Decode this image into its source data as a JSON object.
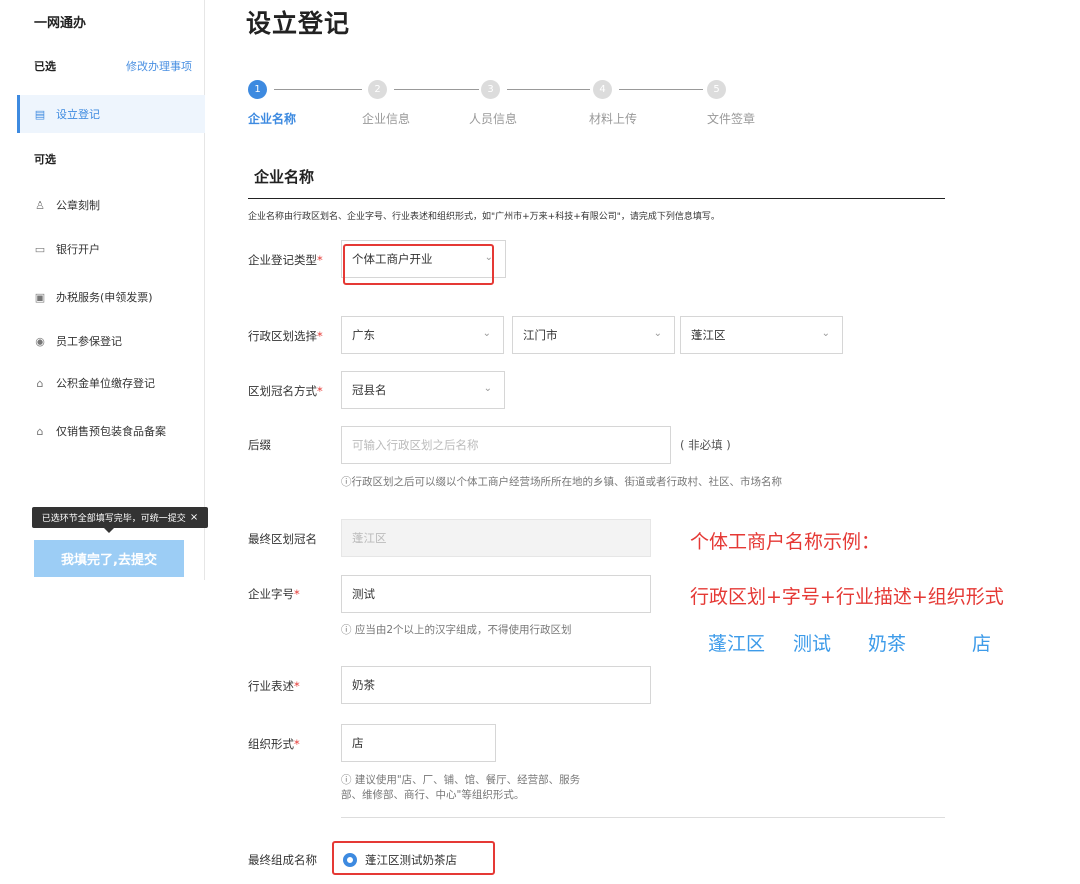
{
  "sidebar": {
    "brand": "一网通办",
    "selected_group": "已选",
    "modify_link": "修改办理事项",
    "optional_group": "可选",
    "items": [
      {
        "label": "设立登记",
        "icon": "▤"
      },
      {
        "label": "公章刻制",
        "icon": "♙"
      },
      {
        "label": "银行开户",
        "icon": "▭"
      },
      {
        "label": "办税服务(申领发票)",
        "icon": "▣"
      },
      {
        "label": "员工参保登记",
        "icon": "◉"
      },
      {
        "label": "公积金单位缴存登记",
        "icon": "⌂"
      },
      {
        "label": "仅销售预包装食品备案",
        "icon": "⌂"
      }
    ],
    "tooltip": "已选环节全部填写完毕，可统一提交",
    "tooltip_close": "×",
    "submit_label": "我填完了,去提交"
  },
  "page_title": "设立登记",
  "steps": [
    {
      "num": "1",
      "label": "企业名称"
    },
    {
      "num": "2",
      "label": "企业信息"
    },
    {
      "num": "3",
      "label": "人员信息"
    },
    {
      "num": "4",
      "label": "材料上传"
    },
    {
      "num": "5",
      "label": "文件签章"
    }
  ],
  "section": {
    "title": "企业名称",
    "description": "企业名称由行政区划名、企业字号、行业表述和组织形式，如\"广州市+万来+科技+有限公司\"，请完成下列信息填写。"
  },
  "form": {
    "reg_type": {
      "label": "企业登记类型",
      "required": "*",
      "value": "个体工商户开业"
    },
    "region": {
      "label": "行政区划选择",
      "required": "*",
      "province": "广东",
      "city": "江门市",
      "district": "蓬江区"
    },
    "prefix_mode": {
      "label": "区划冠名方式",
      "required": "*",
      "value": "冠县名"
    },
    "suffix": {
      "label": "后缀",
      "placeholder": "可输入行政区划之后名称",
      "optional": "( 非必填 )",
      "hint": "ⓘ行政区划之后可以缀以个体工商户经营场所所在地的乡镇、街道或者行政村、社区、市场名称"
    },
    "final_prefix": {
      "label": "最终区划冠名",
      "value": "蓬江区"
    },
    "trade_name": {
      "label": "企业字号",
      "required": "*",
      "value": "测试",
      "hint": "ⓘ 应当由2个以上的汉字组成，不得使用行政区划"
    },
    "industry": {
      "label": "行业表述",
      "required": "*",
      "value": "奶茶"
    },
    "org_form": {
      "label": "组织形式",
      "required": "*",
      "value": "店",
      "hint_line1": "ⓘ 建议使用\"店、厂、铺、馆、餐厅、经营部、服务",
      "hint_line2": "部、维修部、商行、中心\"等组织形式。"
    },
    "final_name": {
      "label": "最终组成名称",
      "value": "蓬江区测试奶茶店"
    }
  },
  "example": {
    "title": "个体工商户名称示例：",
    "formula": "行政区划+字号+行业描述+组织形式",
    "parts": [
      "蓬江区",
      "测试",
      "奶茶",
      "店"
    ]
  },
  "colors": {
    "accent": "#3d8ae0",
    "highlight": "#e53935",
    "example_blue": "#3d9be9"
  }
}
